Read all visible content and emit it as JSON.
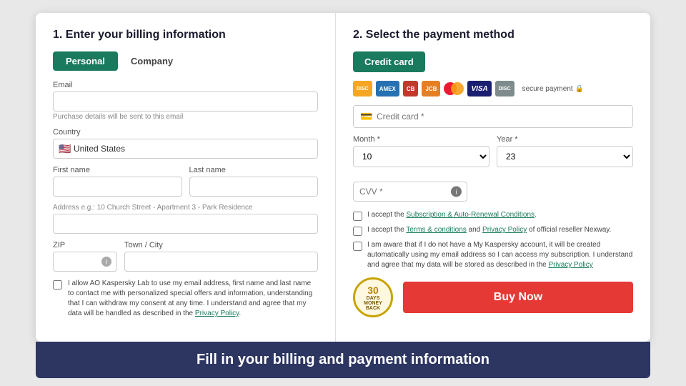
{
  "left": {
    "title": "1. Enter your billing information",
    "tabs": [
      {
        "label": "Personal",
        "active": true
      },
      {
        "label": "Company",
        "active": false
      }
    ],
    "email": {
      "label": "Email",
      "placeholder": "",
      "hint": "Purchase details will be sent to this email"
    },
    "country": {
      "label": "Country",
      "value": "United States",
      "flag": "🇺🇸"
    },
    "first_name": {
      "label": "First name"
    },
    "last_name": {
      "label": "Last name"
    },
    "address": {
      "hint": "Address e.g.: 10 Church Street - Apartment 3 - Park Residence",
      "placeholder": ""
    },
    "zip": {
      "label": "ZIP"
    },
    "city": {
      "label": "Town / City"
    },
    "checkbox_label": "I allow AO Kaspersky Lab to use my email address, first name and last name to contact me with personalized special offers and information, understanding that I can withdraw my consent at any time. I understand and agree that my data will be handled as described in the ",
    "checkbox_link": "Privacy Policy"
  },
  "right": {
    "title": "2. Select the payment method",
    "credit_card_btn": "Credit card",
    "secure_payment": "secure payment",
    "card_number_placeholder": "Credit card *",
    "month_label": "Month *",
    "month_value": "10",
    "year_label": "Year *",
    "year_value": "23",
    "cvv_label": "CVV *",
    "terms": [
      {
        "text_before": "I accept the ",
        "link_text": "Subscription & Auto-Renewal Conditions",
        "text_after": "."
      },
      {
        "text_before": "I accept the ",
        "link1_text": "Terms & conditions",
        "text_mid": " and ",
        "link2_text": "Privacy Policy",
        "text_after": " of official reseller Nexway."
      },
      {
        "text_before": "I am aware that if I do not have a My Kaspersky account, it will be created automatically using my email address so I can access my subscription. I understand and agree that my data will be stored as described in the ",
        "link_text": "Privacy Policy"
      }
    ],
    "money_back": {
      "days": "30",
      "line1": "DAYS",
      "line2": "MONEY",
      "line3": "BACK"
    },
    "buy_button": "Buy Now"
  },
  "bottom_bar": {
    "text": "Fill in your billing and payment information"
  }
}
